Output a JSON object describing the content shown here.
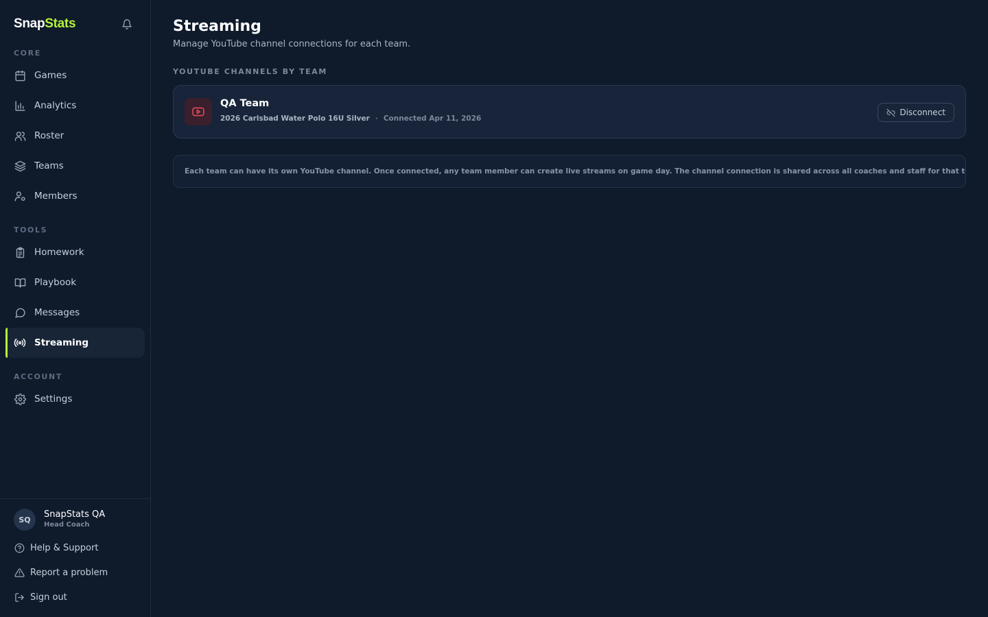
{
  "brand": {
    "part1": "Snap",
    "part2": "Stats"
  },
  "sidebar": {
    "sections": {
      "core": "CORE",
      "tools": "TOOLS",
      "account": "ACCOUNT"
    },
    "items": {
      "games": "Games",
      "analytics": "Analytics",
      "roster": "Roster",
      "teams": "Teams",
      "members": "Members",
      "homework": "Homework",
      "playbook": "Playbook",
      "messages": "Messages",
      "streaming": "Streaming",
      "settings": "Settings"
    },
    "active_item": "Streaming",
    "user": {
      "initials": "SQ",
      "name": "SnapStats QA",
      "role": "Head Coach"
    },
    "footer": {
      "help": "Help & Support",
      "report": "Report a problem",
      "signout": "Sign out"
    }
  },
  "main": {
    "title": "Streaming",
    "subtitle": "Manage YouTube channel connections for each team.",
    "section_label": "YOUTUBE CHANNELS BY TEAM",
    "teams": [
      {
        "name": "QA Team",
        "channel": "2026 Carlsbad Water Polo 16U Silver",
        "separator": "·",
        "connected": "Connected Apr 11, 2026",
        "action": "Disconnect"
      }
    ],
    "info": "Each team can have its own YouTube channel. Once connected, any team member can create live streams on game day. The channel connection is shared across all coaches and staff for that team."
  },
  "colors": {
    "background": "#0f1a2b",
    "accent": "#b5f23d",
    "youtube": "#e04a5a"
  },
  "icons": {
    "bell": "bell-icon",
    "games": "calendar-icon",
    "analytics": "bar-chart-icon",
    "roster": "users-icon",
    "teams": "layers-icon",
    "members": "user-cog-icon",
    "homework": "clipboard-icon",
    "playbook": "book-icon",
    "messages": "message-circle-icon",
    "streaming": "radio-icon",
    "settings": "gear-icon",
    "help": "help-circle-icon",
    "report": "alert-triangle-icon",
    "signout": "log-out-icon",
    "youtube": "youtube-icon",
    "disconnect": "unlink-icon"
  }
}
